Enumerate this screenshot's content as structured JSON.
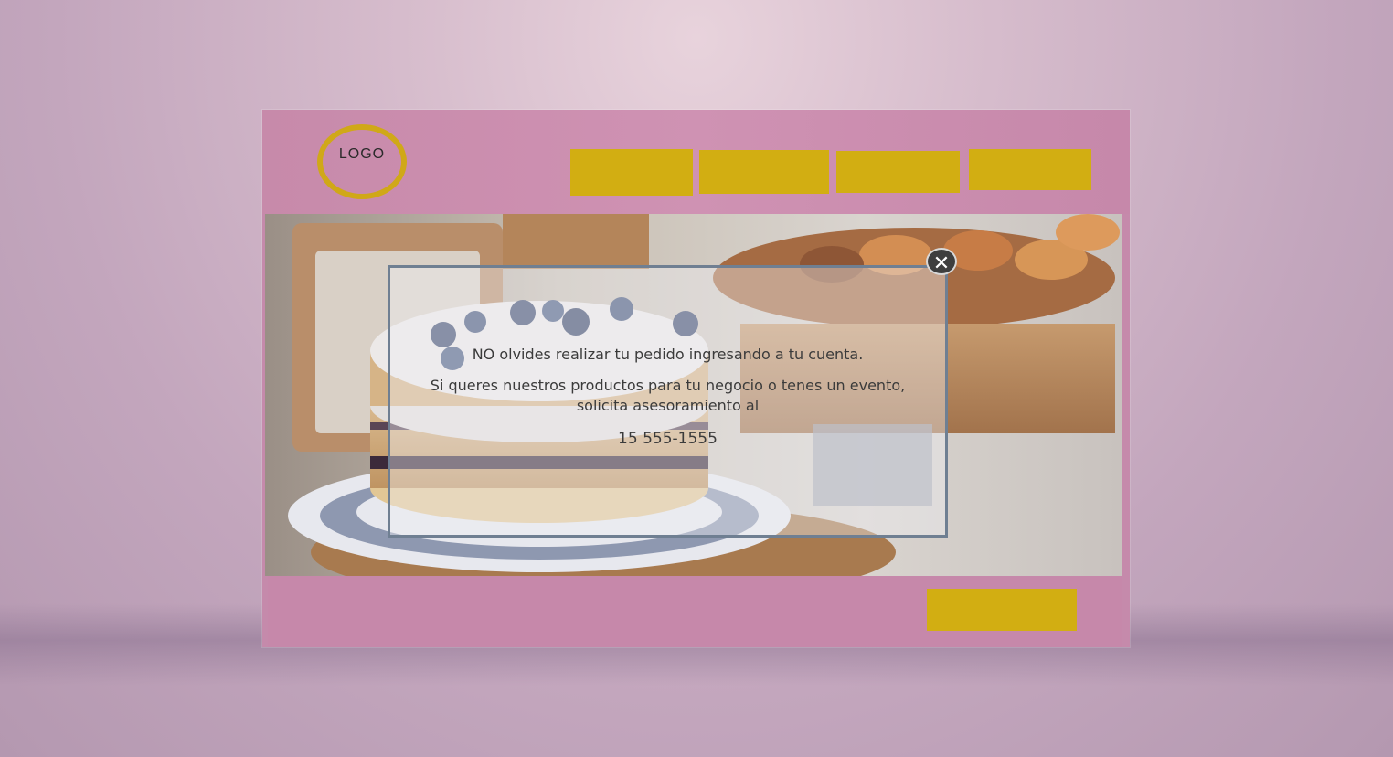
{
  "logo": {
    "text": "LOGO"
  },
  "nav": {
    "buttons": [
      "",
      "",
      "",
      ""
    ]
  },
  "modal": {
    "line1": "NO olvides realizar tu pedido ingresando a tu cuenta.",
    "line2": "Si queres nuestros productos para tu negocio o tenes un evento, solicita asesoramiento al",
    "phone": "15 555-1555",
    "close_icon": "close-icon"
  },
  "footer": {
    "button_label": ""
  },
  "colors": {
    "background": "#d6bccc",
    "header": "#c78aaa",
    "accent_yellow": "#d2ae12",
    "modal_border": "#6f7f92"
  }
}
